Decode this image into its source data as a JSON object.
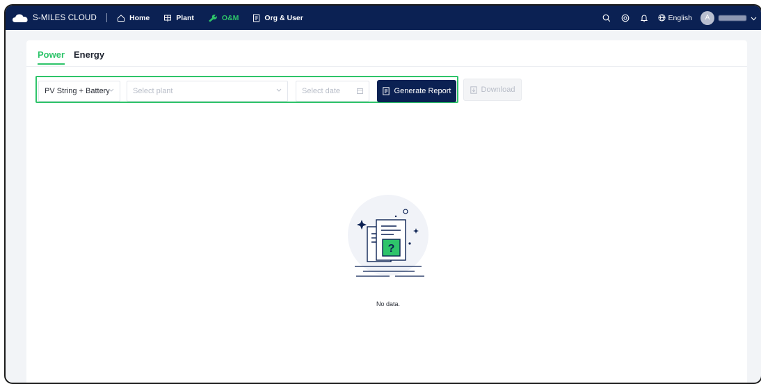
{
  "brand": {
    "name": "S-MILES CLOUD"
  },
  "nav": {
    "items": [
      {
        "label": "Home",
        "icon": "home-icon"
      },
      {
        "label": "Plant",
        "icon": "plant-icon"
      },
      {
        "label": "O&M",
        "icon": "wrench-icon",
        "active": true
      },
      {
        "label": "Org & User",
        "icon": "document-icon"
      }
    ]
  },
  "toolbar": {
    "language": "English",
    "avatar_initial": "A"
  },
  "tabs": [
    {
      "label": "Power",
      "active": true
    },
    {
      "label": "Energy",
      "active": false
    }
  ],
  "filters": {
    "type_value": "PV String + Battery",
    "plant_placeholder": "Select plant",
    "date_placeholder": "Select date",
    "generate_label": "Generate Report",
    "download_label": "Download"
  },
  "empty_state": {
    "message": "No data."
  },
  "colors": {
    "nav_bg": "#0b2153",
    "accent": "#2ec46a",
    "primary_button": "#0b2153"
  }
}
